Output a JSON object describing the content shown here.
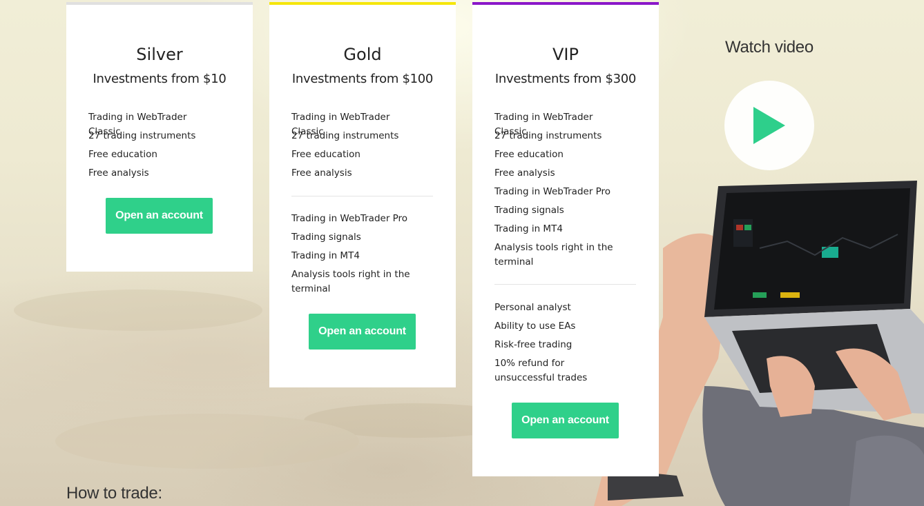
{
  "plans": [
    {
      "name": "Silver",
      "investment": "Investments from $10",
      "accent": "#e0e0e0",
      "features": [
        "Trading in WebTrader Classic",
        "27 trading instruments",
        "Free education",
        "Free analysis"
      ],
      "button": "Open an account"
    },
    {
      "name": "Gold",
      "investment": "Investments from $100",
      "accent": "#f5e60a",
      "features": [
        "Trading in WebTrader Classic",
        "27 trading instruments",
        "Free education",
        "Free analysis"
      ],
      "extra_features": [
        "Trading in WebTrader Pro",
        "Trading signals",
        "Trading in MT4",
        "Analysis tools right in the terminal"
      ],
      "button": "Open an account"
    },
    {
      "name": "VIP",
      "investment": "Investments from $300",
      "accent": "#8a17c9",
      "features": [
        "Trading in WebTrader Classic",
        "27 trading instruments",
        "Free education",
        "Free analysis",
        "Trading in WebTrader Pro",
        "Trading signals",
        "Trading in MT4",
        "Analysis tools right in the terminal"
      ],
      "extra_features": [
        "Personal analyst",
        "Ability to use EAs",
        "Risk-free trading",
        "10% refund for unsuccessful trades"
      ],
      "button": "Open an account"
    }
  ],
  "video": {
    "title": "Watch video",
    "icon": "play-icon"
  },
  "how_to": "How to trade:",
  "colors": {
    "button": "#2fd08a",
    "play": "#2ecf8b"
  }
}
